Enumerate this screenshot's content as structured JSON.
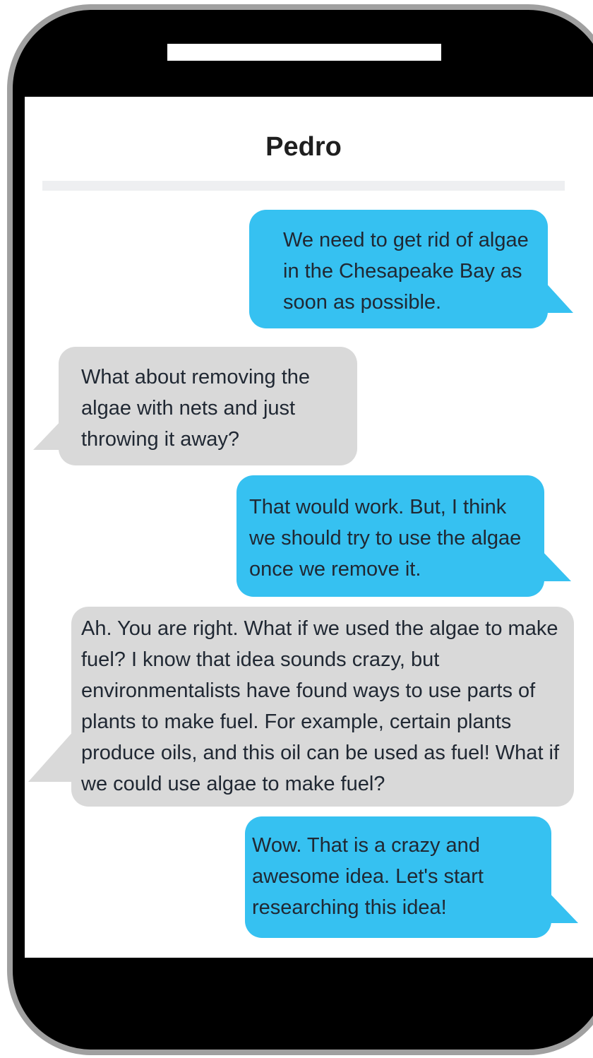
{
  "conversation": {
    "contact_name": "Pedro",
    "messages": [
      {
        "direction": "outgoing",
        "text": "We need to get rid of algae in the Chesapeake Bay as soon as possible."
      },
      {
        "direction": "incoming",
        "text": "What about removing the algae with nets and just throwing it away?"
      },
      {
        "direction": "outgoing",
        "text": "That would work. But, I think we should try to use the algae once we remove it."
      },
      {
        "direction": "incoming",
        "text": "Ah. You are right. What if we used the algae to make fuel? I know that idea sounds crazy, but environmentalists have found ways to use parts of plants to make fuel. For example, certain plants produce oils, and this oil can be used as fuel! What if we could use algae to make fuel?"
      },
      {
        "direction": "outgoing",
        "text": "Wow. That is a crazy and awesome idea. Let's start researching this idea!"
      }
    ]
  },
  "colors": {
    "outgoing_bubble": "#36c1f1",
    "incoming_bubble": "#d9d9d9",
    "phone_body": "#000000",
    "phone_frame": "#a0a0a0"
  }
}
